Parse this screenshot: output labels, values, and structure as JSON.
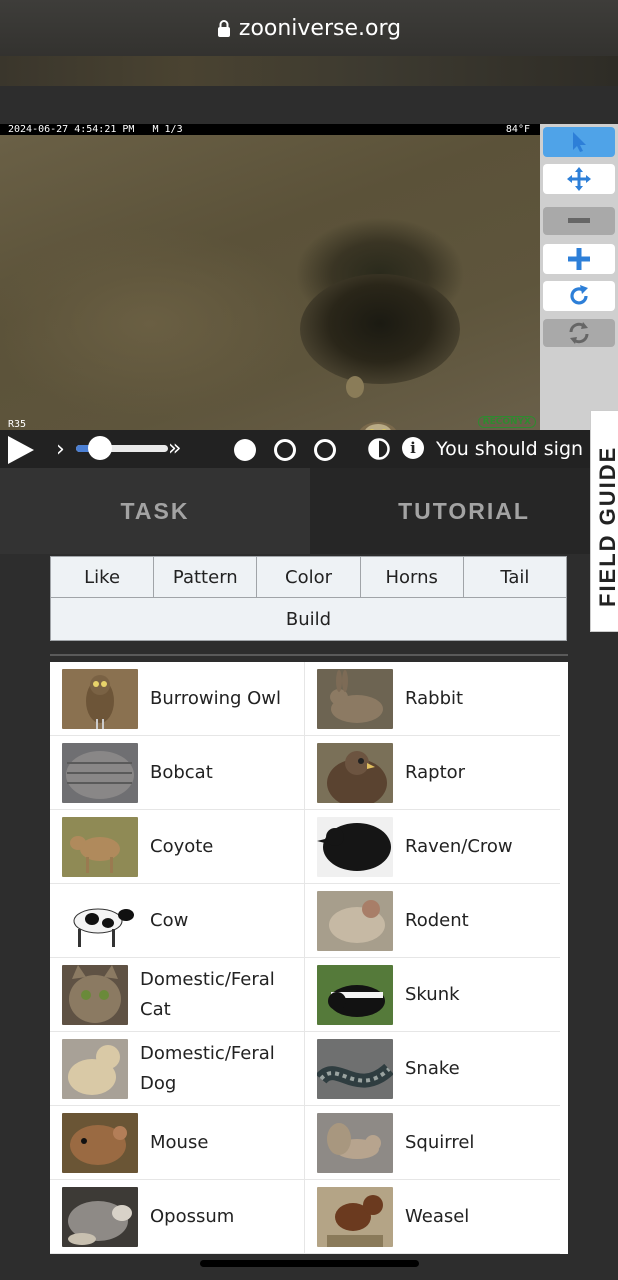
{
  "browser": {
    "url": "zooniverse.org"
  },
  "subject": {
    "stamp_left": "2024-06-27 4:54:21 PM   M 1/3",
    "stamp_right": "84°F",
    "camera_id": "R35",
    "brand": "RECONYX"
  },
  "toolbar": {
    "tools": [
      "pointer-icon",
      "move-icon",
      "zoom-out-icon",
      "zoom-in-icon",
      "rotate-icon",
      "reset-icon"
    ]
  },
  "controls": {
    "frame_progress": 0.15,
    "signin_text": "You should sign",
    "frames": 3,
    "current_frame": 1
  },
  "tabs": {
    "task": "TASK",
    "tutorial": "TUTORIAL"
  },
  "field_guide": "FIELD GUIDE",
  "filters": {
    "row1": [
      "Like",
      "Pattern",
      "Color",
      "Horns",
      "Tail"
    ],
    "build": "Build"
  },
  "choices": [
    {
      "label": "Burrowing Owl",
      "thumb": "owl"
    },
    {
      "label": "Rabbit",
      "thumb": "rabbit"
    },
    {
      "label": "Bobcat",
      "thumb": "bobcat"
    },
    {
      "label": "Raptor",
      "thumb": "raptor"
    },
    {
      "label": "Coyote",
      "thumb": "coyote"
    },
    {
      "label": "Raven/Crow",
      "thumb": "raven"
    },
    {
      "label": "Cow",
      "thumb": "cow"
    },
    {
      "label": "Rodent",
      "thumb": "rodent"
    },
    {
      "label": "Domestic/Feral Cat",
      "thumb": "cat"
    },
    {
      "label": "Skunk",
      "thumb": "skunk"
    },
    {
      "label": "Domestic/Feral Dog",
      "thumb": "dog"
    },
    {
      "label": "Snake",
      "thumb": "snake"
    },
    {
      "label": "Mouse",
      "thumb": "mouse"
    },
    {
      "label": "Squirrel",
      "thumb": "squirrel"
    },
    {
      "label": "Opossum",
      "thumb": "opossum"
    },
    {
      "label": "Weasel",
      "thumb": "weasel"
    }
  ]
}
